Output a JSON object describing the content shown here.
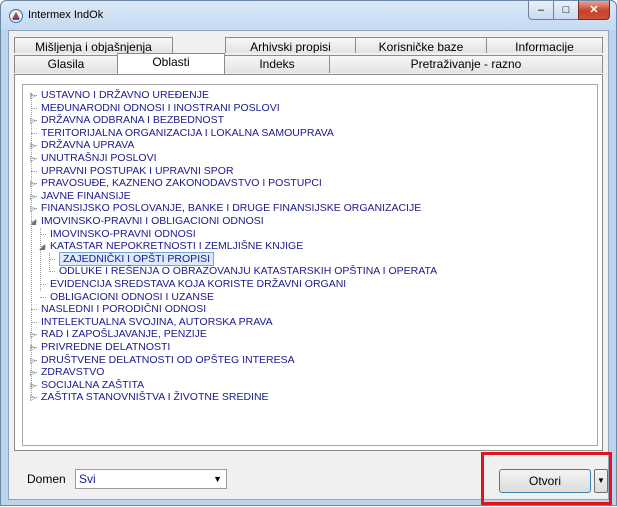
{
  "window": {
    "title": "Intermex IndOk",
    "minimize_glyph": "–",
    "maximize_glyph": "□",
    "close_glyph": "✕"
  },
  "tabs": {
    "row1": [
      "Mišljenja i objašnjenja",
      "Arhivski propisi",
      "Korisničke baze",
      "Informacije"
    ],
    "row2": [
      "Glasila",
      "Oblasti",
      "Indeks",
      "Pretraživanje - razno"
    ],
    "active": "Oblasti"
  },
  "tree": {
    "items": [
      {
        "label": "USTAVNO I DRŽAVNO UREĐENJE",
        "level": 0,
        "glyph": "▷"
      },
      {
        "label": "MEĐUNARODNI ODNOSI I INOSTRANI POSLOVI",
        "level": 0,
        "glyph": ""
      },
      {
        "label": "DRŽAVNA ODBRANA I BEZBEDNOST",
        "level": 0,
        "glyph": "▷"
      },
      {
        "label": "TERITORIJALNA ORGANIZACIJA I LOKALNA SAMOUPRAVA",
        "level": 0,
        "glyph": ""
      },
      {
        "label": "DRŽAVNA UPRAVA",
        "level": 0,
        "glyph": "▷"
      },
      {
        "label": "UNUTRAŠNJI POSLOVI",
        "level": 0,
        "glyph": "▷"
      },
      {
        "label": "UPRAVNI POSTUPAK I UPRAVNI SPOR",
        "level": 0,
        "glyph": ""
      },
      {
        "label": "PRAVOSUĐE, KAZNENO ZAKONODAVSTVO I POSTUPCI",
        "level": 0,
        "glyph": "▷"
      },
      {
        "label": "JAVNE FINANSIJE",
        "level": 0,
        "glyph": "▷"
      },
      {
        "label": "FINANSIJSKO POSLOVANJE, BANKE I DRUGE FINANSIJSKE ORGANIZACIJE",
        "level": 0,
        "glyph": "▷"
      },
      {
        "label": "IMOVINSKO-PRAVNI I OBLIGACIONI ODNOSI",
        "level": 0,
        "glyph": "◢"
      },
      {
        "label": "IMOVINSKO-PRAVNI ODNOSI",
        "level": 1,
        "glyph": ""
      },
      {
        "label": "KATASTAR NEPOKRETNOSTI I ZEMLJIŠNE KNJIGE",
        "level": 1,
        "glyph": "◢"
      },
      {
        "label": "ZAJEDNIČKI I OPŠTI PROPISI",
        "level": 2,
        "glyph": "",
        "selected": true
      },
      {
        "label": "ODLUKE I REŠENJA O OBRAZOVANJU KATASTARSKIH OPŠTINA I OPERATA",
        "level": 2,
        "glyph": ""
      },
      {
        "label": "EVIDENCIJA SREDSTAVA KOJA KORISTE DRŽAVNI ORGANI",
        "level": 1,
        "glyph": ""
      },
      {
        "label": "OBLIGACIONI ODNOSI I UZANSE",
        "level": 1,
        "glyph": ""
      },
      {
        "label": "NASLEDNI I PORODIČNI ODNOSI",
        "level": 0,
        "glyph": ""
      },
      {
        "label": "INTELEKTUALNA SVOJINA, AUTORSKA PRAVA",
        "level": 0,
        "glyph": ""
      },
      {
        "label": "RAD I ZAPOŠLJAVANJE, PENZIJE",
        "level": 0,
        "glyph": "▷"
      },
      {
        "label": "PRIVREDNE DELATNOSTI",
        "level": 0,
        "glyph": "▷"
      },
      {
        "label": "DRUŠTVENE DELATNOSTI OD OPŠTEG INTERESA",
        "level": 0,
        "glyph": "▷"
      },
      {
        "label": "ZDRAVSTVO",
        "level": 0,
        "glyph": "▷"
      },
      {
        "label": "SOCIJALNA ZAŠTITA",
        "level": 0,
        "glyph": "▷"
      },
      {
        "label": "ZAŠTITA STANOVNIŠTVA I ŽIVOTNE SREDINE",
        "level": 0,
        "glyph": "▷"
      }
    ]
  },
  "footer": {
    "domen_label": "Domen",
    "domen_value": "Svi",
    "open_label": "Otvori",
    "dropdown_glyph": "▼"
  },
  "colors": {
    "tree_text": "#1a1a8c",
    "highlight": "#e0141c",
    "selection": "#dcebfc"
  }
}
